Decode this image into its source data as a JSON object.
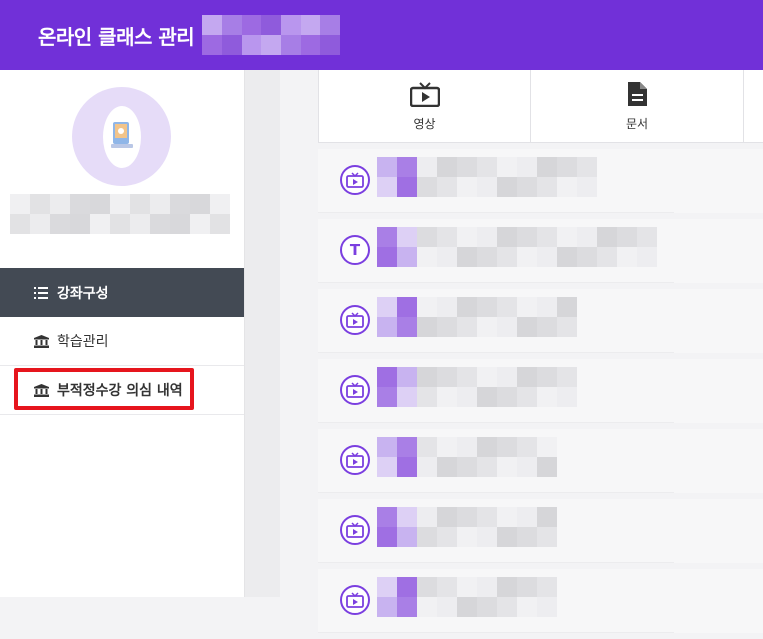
{
  "header": {
    "title": "온라인 클래스 관리",
    "brand_color": "#7130d8"
  },
  "sidebar": {
    "nav": [
      {
        "label": "강좌구성",
        "icon": "list-icon",
        "active": true
      },
      {
        "label": "학습관리",
        "icon": "institution-icon",
        "active": false
      },
      {
        "label": "부적정수강 의심 내역",
        "icon": "institution-icon",
        "active": false,
        "highlighted": true
      }
    ]
  },
  "tabs": [
    {
      "label": "영상",
      "icon": "tv-icon"
    },
    {
      "label": "문서",
      "icon": "document-icon"
    }
  ],
  "lessons": [
    {
      "type": "video",
      "icon": "tv-icon"
    },
    {
      "type": "text",
      "icon": "text-icon",
      "glyph": "T"
    },
    {
      "type": "video",
      "icon": "tv-icon"
    },
    {
      "type": "video",
      "icon": "tv-icon"
    },
    {
      "type": "video",
      "icon": "tv-icon"
    },
    {
      "type": "video",
      "icon": "tv-icon"
    },
    {
      "type": "video",
      "icon": "tv-icon"
    }
  ],
  "colors": {
    "accent": "#7b3fe0",
    "highlight_box": "#e6151d",
    "active_nav_bg": "#434a54"
  }
}
